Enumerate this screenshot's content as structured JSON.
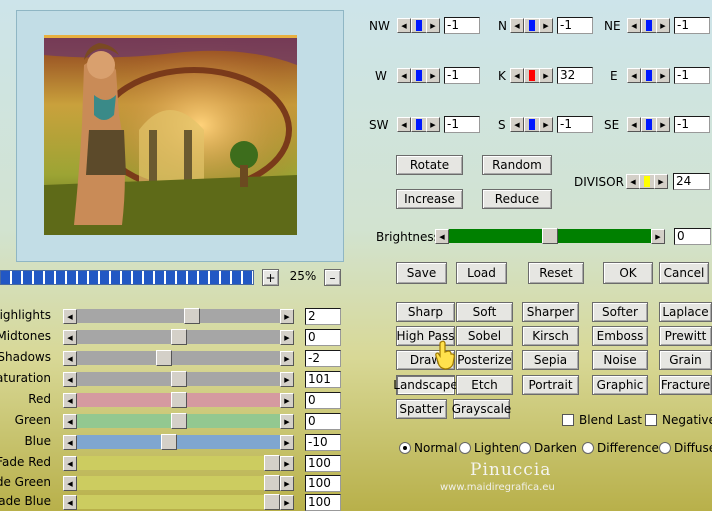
{
  "matrix": {
    "rows": [
      [
        {
          "label": "NW",
          "value": "-1",
          "knob": "#0018ff"
        },
        {
          "label": "N",
          "value": "-1",
          "knob": "#0018ff"
        },
        {
          "label": "NE",
          "value": "-1",
          "knob": "#0018ff"
        }
      ],
      [
        {
          "label": "W",
          "value": "-1",
          "knob": "#0018ff"
        },
        {
          "label": "K",
          "value": "32",
          "knob": "#ff0000"
        },
        {
          "label": "E",
          "value": "-1",
          "knob": "#0018ff"
        }
      ],
      [
        {
          "label": "SW",
          "value": "-1",
          "knob": "#0018ff"
        },
        {
          "label": "S",
          "value": "-1",
          "knob": "#0018ff"
        },
        {
          "label": "SE",
          "value": "-1",
          "knob": "#0018ff"
        }
      ]
    ],
    "divisor_label": "DIVISOR",
    "divisor_value": "24",
    "divisor_knob": "#ffff00"
  },
  "buttons": {
    "rotate": "Rotate",
    "random": "Random",
    "increase": "Increase",
    "reduce": "Reduce",
    "save": "Save",
    "load": "Load",
    "reset": "Reset",
    "ok": "OK",
    "cancel": "Cancel"
  },
  "brightness": {
    "label": "Brightness",
    "value": "0",
    "level": 0.5,
    "color": "#008000"
  },
  "zoom": {
    "value": "25%",
    "plus": "+",
    "minus": "–"
  },
  "sliders": [
    {
      "label": "Highlights",
      "value": "2",
      "level": 0.57,
      "color": "#a6a6a6"
    },
    {
      "label": "Midtones",
      "value": "0",
      "level": 0.5,
      "color": "#a6a6a6"
    },
    {
      "label": "Shadows",
      "value": "-2",
      "level": 0.42,
      "color": "#a6a6a6"
    },
    {
      "label": "Saturation",
      "value": "101",
      "level": 0.5,
      "color": "#a6a6a6"
    },
    {
      "label": "Red",
      "value": "0",
      "level": 0.5,
      "color": "#d59aa0"
    },
    {
      "label": "Green",
      "value": "0",
      "level": 0.5,
      "color": "#93c890"
    },
    {
      "label": "Blue",
      "value": "-10",
      "level": 0.45,
      "color": "#7fa6d0"
    },
    {
      "label": "Fade Red",
      "value": "100",
      "level": 1.0,
      "color": "#cccc60"
    },
    {
      "label": "Fade Green",
      "value": "100",
      "level": 1.0,
      "color": "#cccc60"
    },
    {
      "label": "Fade Blue",
      "value": "100",
      "level": 1.0,
      "color": "#cccc60"
    }
  ],
  "presets": [
    [
      "Sharp",
      "Soft",
      "Sharper",
      "Softer",
      "Laplace"
    ],
    [
      "High Pass",
      "Sobel",
      "Kirsch",
      "Emboss",
      "Prewitt"
    ],
    [
      "Draw",
      "Posterize",
      "Sepia",
      "Noise",
      "Grain"
    ],
    [
      "Landscape",
      "Etch",
      "Portrait",
      "Graphic",
      "Fracture"
    ],
    [
      "Spatter",
      "Grayscale"
    ]
  ],
  "checkboxes": {
    "blend_last": "Blend Last",
    "negative": "Negative"
  },
  "modes": [
    "Normal",
    "Lighten",
    "Darken",
    "Difference",
    "Diffuse"
  ],
  "selected_mode": "Normal",
  "watermark": {
    "name": "Pinuccia",
    "url": "www.maidiregrafica.eu"
  }
}
